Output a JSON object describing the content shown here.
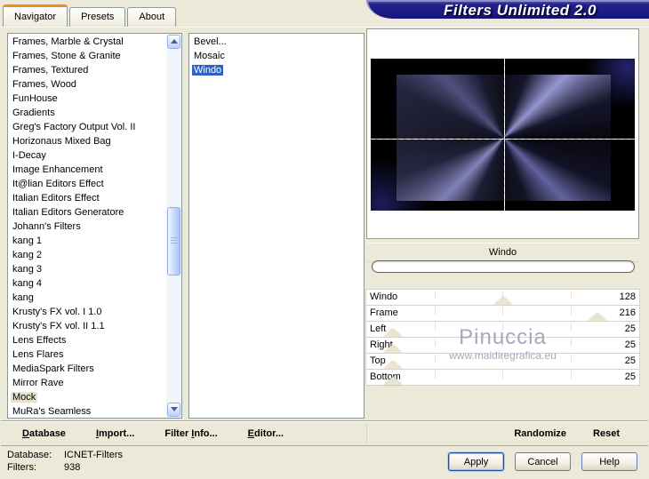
{
  "window": {
    "title": "Filters Unlimited 2.0"
  },
  "tabs": [
    {
      "label": "Navigator",
      "active": true
    },
    {
      "label": "Presets",
      "active": false
    },
    {
      "label": "About",
      "active": false
    }
  ],
  "category_list": {
    "selected": "Mock",
    "items": [
      "Frames, Marble & Crystal",
      "Frames, Stone & Granite",
      "Frames, Textured",
      "Frames, Wood",
      "FunHouse",
      "Gradients",
      "Greg's Factory Output Vol. II",
      "Horizonaus Mixed Bag",
      "I-Decay",
      "Image Enhancement",
      "It@lian Editors Effect",
      "Italian Editors Effect",
      "Italian Editors Generatore",
      "Johann's Filters",
      "kang 1",
      "kang 2",
      "kang 3",
      "kang 4",
      "kang",
      "Krusty's FX vol. I 1.0",
      "Krusty's FX vol. II 1.1",
      "Lens Effects",
      "Lens Flares",
      "MediaSpark Filters",
      "Mirror Rave",
      "Mock",
      "MuRa's Seamless"
    ]
  },
  "filter_list": {
    "selected": "Windo",
    "items": [
      "Bevel...",
      "Mosaic",
      "Windo"
    ]
  },
  "preview": {
    "label": "Windo",
    "progress_percent": 0
  },
  "sliders": {
    "max": 255,
    "rows": [
      {
        "label": "Windo",
        "value": 128
      },
      {
        "label": "Frame",
        "value": 216
      },
      {
        "label": "Left",
        "value": 25
      },
      {
        "label": "Right",
        "value": 25
      },
      {
        "label": "Top",
        "value": 25
      },
      {
        "label": "Bottom",
        "value": 25
      }
    ]
  },
  "watermark": {
    "name": "Pinuccia",
    "url": "www.maidiregrafica.eu"
  },
  "footer": {
    "left": [
      {
        "name": "database",
        "label": "Database",
        "accel": 0
      },
      {
        "name": "import",
        "label": "Import...",
        "accel": 0
      },
      {
        "name": "filter-info",
        "label": "Filter Info...",
        "accel": 7
      },
      {
        "name": "editor",
        "label": "Editor...",
        "accel": 0
      }
    ],
    "right": [
      {
        "name": "randomize",
        "label": "Randomize",
        "accel": null
      },
      {
        "name": "reset",
        "label": "Reset",
        "accel": null
      }
    ]
  },
  "status": {
    "database_label": "Database:",
    "database_value": "ICNET-Filters",
    "filters_label": "Filters:",
    "filters_value": "938"
  },
  "dialog_buttons": {
    "apply": "Apply",
    "cancel": "Cancel",
    "help": "Help"
  },
  "colors": {
    "background": "#ece9d8",
    "banner": "#15157c",
    "selection": "#2f62c6",
    "inactive_selection": "#e6e2cc",
    "tab_accent": "#f08c1e",
    "watermark": "#a9a7bd"
  }
}
